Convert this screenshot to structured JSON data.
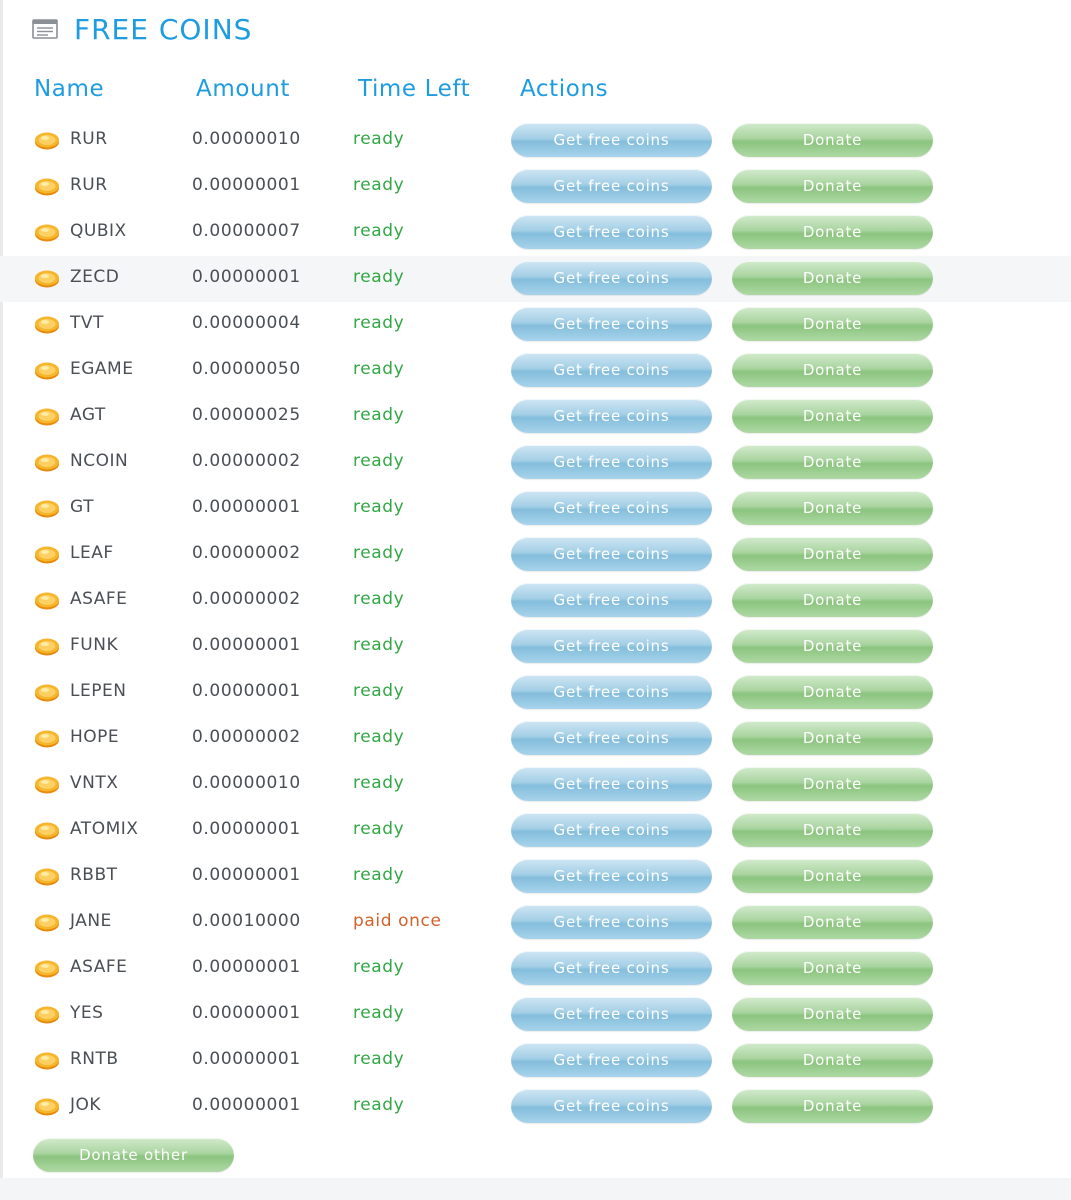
{
  "header": {
    "icon": "list-icon",
    "title": "FREE COINS"
  },
  "columns": {
    "name": "Name",
    "amount": "Amount",
    "time_left": "Time Left",
    "actions": "Actions"
  },
  "colors": {
    "accent": "#1e9ce0",
    "ready": "#32a744",
    "paid": "#d2622a",
    "get_button": "#a4cfe6",
    "donate_button": "#a9d49f"
  },
  "actions": {
    "get_label": "Get free coins",
    "donate_label": "Donate"
  },
  "rows": [
    {
      "name": "RUR",
      "amount": "0.00000010",
      "time_left": "ready"
    },
    {
      "name": "RUR",
      "amount": "0.00000001",
      "time_left": "ready"
    },
    {
      "name": "QUBIX",
      "amount": "0.00000007",
      "time_left": "ready"
    },
    {
      "name": "ZECD",
      "amount": "0.00000001",
      "time_left": "ready"
    },
    {
      "name": "TVT",
      "amount": "0.00000004",
      "time_left": "ready"
    },
    {
      "name": "EGAME",
      "amount": "0.00000050",
      "time_left": "ready"
    },
    {
      "name": "AGT",
      "amount": "0.00000025",
      "time_left": "ready"
    },
    {
      "name": "NCOIN",
      "amount": "0.00000002",
      "time_left": "ready"
    },
    {
      "name": "GT",
      "amount": "0.00000001",
      "time_left": "ready"
    },
    {
      "name": "LEAF",
      "amount": "0.00000002",
      "time_left": "ready"
    },
    {
      "name": "ASAFE",
      "amount": "0.00000002",
      "time_left": "ready"
    },
    {
      "name": "FUNK",
      "amount": "0.00000001",
      "time_left": "ready"
    },
    {
      "name": "LEPEN",
      "amount": "0.00000001",
      "time_left": "ready"
    },
    {
      "name": "HOPE",
      "amount": "0.00000002",
      "time_left": "ready"
    },
    {
      "name": "VNTX",
      "amount": "0.00000010",
      "time_left": "ready"
    },
    {
      "name": "ATOMIX",
      "amount": "0.00000001",
      "time_left": "ready"
    },
    {
      "name": "RBBT",
      "amount": "0.00000001",
      "time_left": "ready"
    },
    {
      "name": "JANE",
      "amount": "0.00010000",
      "time_left": "paid once"
    },
    {
      "name": "ASAFE",
      "amount": "0.00000001",
      "time_left": "ready"
    },
    {
      "name": "YES",
      "amount": "0.00000001",
      "time_left": "ready"
    },
    {
      "name": "RNTB",
      "amount": "0.00000001",
      "time_left": "ready"
    },
    {
      "name": "JOK",
      "amount": "0.00000001",
      "time_left": "ready"
    }
  ],
  "footer": {
    "donate_other_label": "Donate other"
  }
}
